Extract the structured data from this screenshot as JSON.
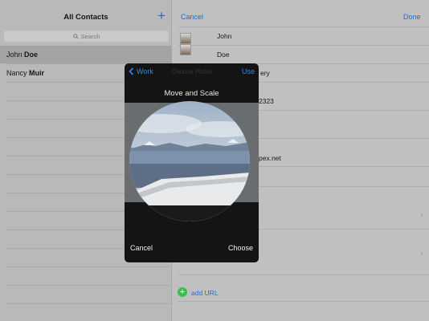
{
  "sidebar": {
    "title": "All Contacts",
    "add_icon": "plus-icon",
    "search_placeholder": "Search",
    "contacts": [
      {
        "first": "John",
        "last": "Doe",
        "selected": true
      },
      {
        "first": "Nancy",
        "last": "Muir",
        "selected": false
      }
    ]
  },
  "detail": {
    "cancel_label": "Cancel",
    "done_label": "Done",
    "first_name": "John",
    "last_name": "Doe",
    "company_fragment": "ery",
    "phone_fragment": "2323",
    "email_fragment": "pex.net",
    "add_url_label": "add URL"
  },
  "popover": {
    "back_label": "Work",
    "use_label": "Use",
    "ghost_title": "Choose Photo",
    "title": "Move and Scale",
    "cancel_label": "Cancel",
    "choose_label": "Choose"
  },
  "colors": {
    "accent": "#1a6fd6",
    "popover_background": "#141414",
    "add_icon_green": "#3dbb55"
  }
}
